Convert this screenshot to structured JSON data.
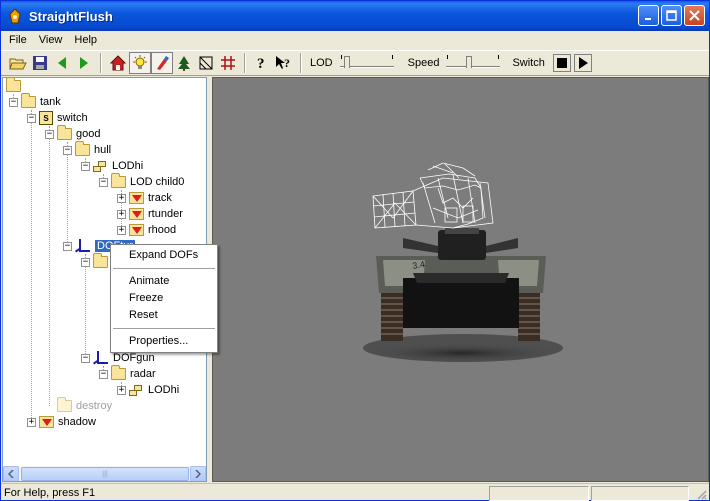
{
  "window": {
    "title": "StraightFlush"
  },
  "menu": [
    "File",
    "View",
    "Help"
  ],
  "toolbar": {
    "lod_label": "LOD",
    "speed_label": "Speed",
    "switch_label": "Switch",
    "icons": [
      "open-folder-icon",
      "save-icon",
      "back-arrow-icon",
      "forward-arrow-icon",
      "home-icon",
      "light-icon",
      "paint-icon",
      "tree-icon",
      "texture-icon",
      "grid-icon",
      "help-icon",
      "context-help-icon",
      "stop-icon",
      "play-icon"
    ]
  },
  "tree": {
    "nodes": {
      "tank": "tank",
      "switch": "switch",
      "good": "good",
      "hull": "hull",
      "lodhi": "LODhi",
      "lodchild0": "LOD child0",
      "track": "track",
      "rtunder": "rtunder",
      "rhood": "rhood",
      "doftur": "DOFtur",
      "dofgun": "DOFgun",
      "radar": "radar",
      "lodhi2": "LODhi",
      "destroy": "destroy",
      "shadow": "shadow"
    }
  },
  "context_menu": {
    "expand": "Expand DOFs",
    "animate": "Animate",
    "freeze": "Freeze",
    "reset": "Reset",
    "properties": "Properties..."
  },
  "status": {
    "text": "For Help, press F1"
  },
  "colors": {
    "titlebar": "#0b57dc",
    "selection": "#316ac5",
    "viewport_bg": "#7c7c7c",
    "folder": "#f8e59a",
    "red_marker": "#e21a1a",
    "dof_blue": "#1c1cb0"
  }
}
